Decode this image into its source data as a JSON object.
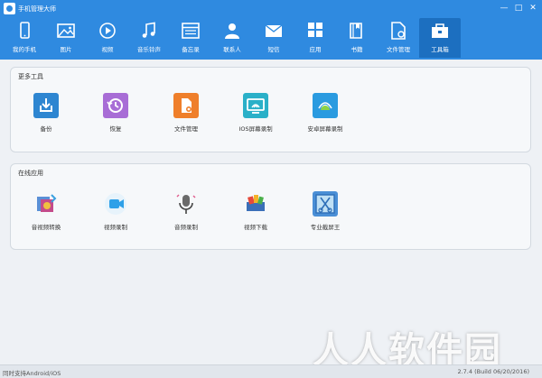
{
  "app": {
    "title": "手机管理大师"
  },
  "window_buttons": [
    "—",
    "□",
    "✕"
  ],
  "nav": [
    {
      "label": "我的手机",
      "icon": "phone-icon"
    },
    {
      "label": "图片",
      "icon": "image-icon"
    },
    {
      "label": "视频",
      "icon": "video-icon"
    },
    {
      "label": "音乐铃声",
      "icon": "music-icon"
    },
    {
      "label": "备忘录",
      "icon": "memo-icon"
    },
    {
      "label": "联系人",
      "icon": "contact-icon"
    },
    {
      "label": "短信",
      "icon": "sms-icon"
    },
    {
      "label": "应用",
      "icon": "apps-icon"
    },
    {
      "label": "书籍",
      "icon": "book-icon"
    },
    {
      "label": "文件管理",
      "icon": "file-manager-icon"
    },
    {
      "label": "工具箱",
      "icon": "toolbox-icon",
      "active": true
    }
  ],
  "more_tools": {
    "title": "更多工具",
    "items": [
      {
        "label": "备份",
        "icon": "backup-icon",
        "color": "#2e86d1"
      },
      {
        "label": "恢复",
        "icon": "restore-icon",
        "color": "#a86dd6"
      },
      {
        "label": "文件管理",
        "icon": "file-manager-icon",
        "color": "#ef7f2a"
      },
      {
        "label": "IOS屏幕录制",
        "icon": "ios-screen-record-icon",
        "color": "#2ab0c8"
      },
      {
        "label": "安卓屏幕录制",
        "icon": "android-screen-record-icon",
        "color": "#2a9be0"
      }
    ]
  },
  "online_apps": {
    "title": "在线应用",
    "items": [
      {
        "label": "音视频转换",
        "icon": "av-convert-icon"
      },
      {
        "label": "视频录制",
        "icon": "video-record-icon"
      },
      {
        "label": "音频录制",
        "icon": "audio-record-icon"
      },
      {
        "label": "视频下载",
        "icon": "video-download-icon"
      },
      {
        "label": "专业截屏王",
        "icon": "screenshot-icon"
      }
    ]
  },
  "status": {
    "left": "同时支持Android/iOS",
    "right": "2.7.4 (Build 06/20/2016)"
  },
  "watermark": "人人软件园"
}
